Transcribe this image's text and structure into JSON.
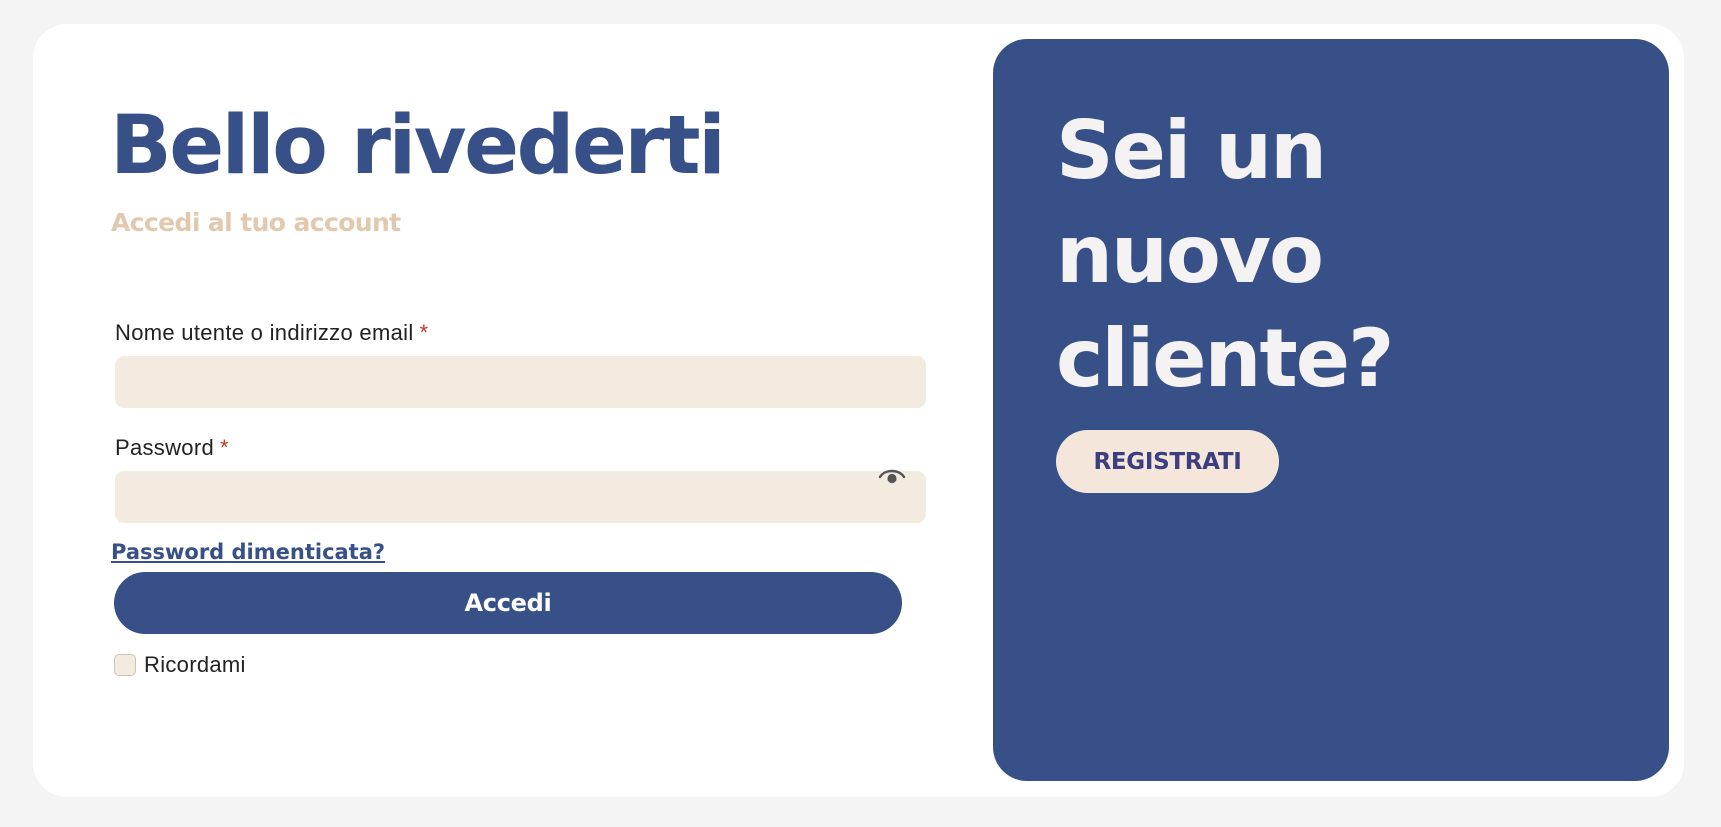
{
  "login": {
    "title": "Bello rivederti",
    "subtitle": "Accedi al tuo account",
    "username_label": "Nome utente o indirizzo email",
    "password_label": "Password",
    "required_marker": "*",
    "username_value": "",
    "password_value": "",
    "forgot_password_label": "Password dimenticata?",
    "submit_label": "Accedi",
    "remember_label": "Ricordami",
    "remember_checked": false
  },
  "register": {
    "title": "Sei un nuovo cliente?",
    "button_label": "REGISTRATI"
  },
  "icons": {
    "show_password": "eye-icon"
  },
  "colors": {
    "primary": "#375087",
    "accent_beige": "#f4ebe0",
    "subtitle": "#e2c9ad",
    "required": "#c8371f",
    "page_background": "#f4f4f4"
  }
}
